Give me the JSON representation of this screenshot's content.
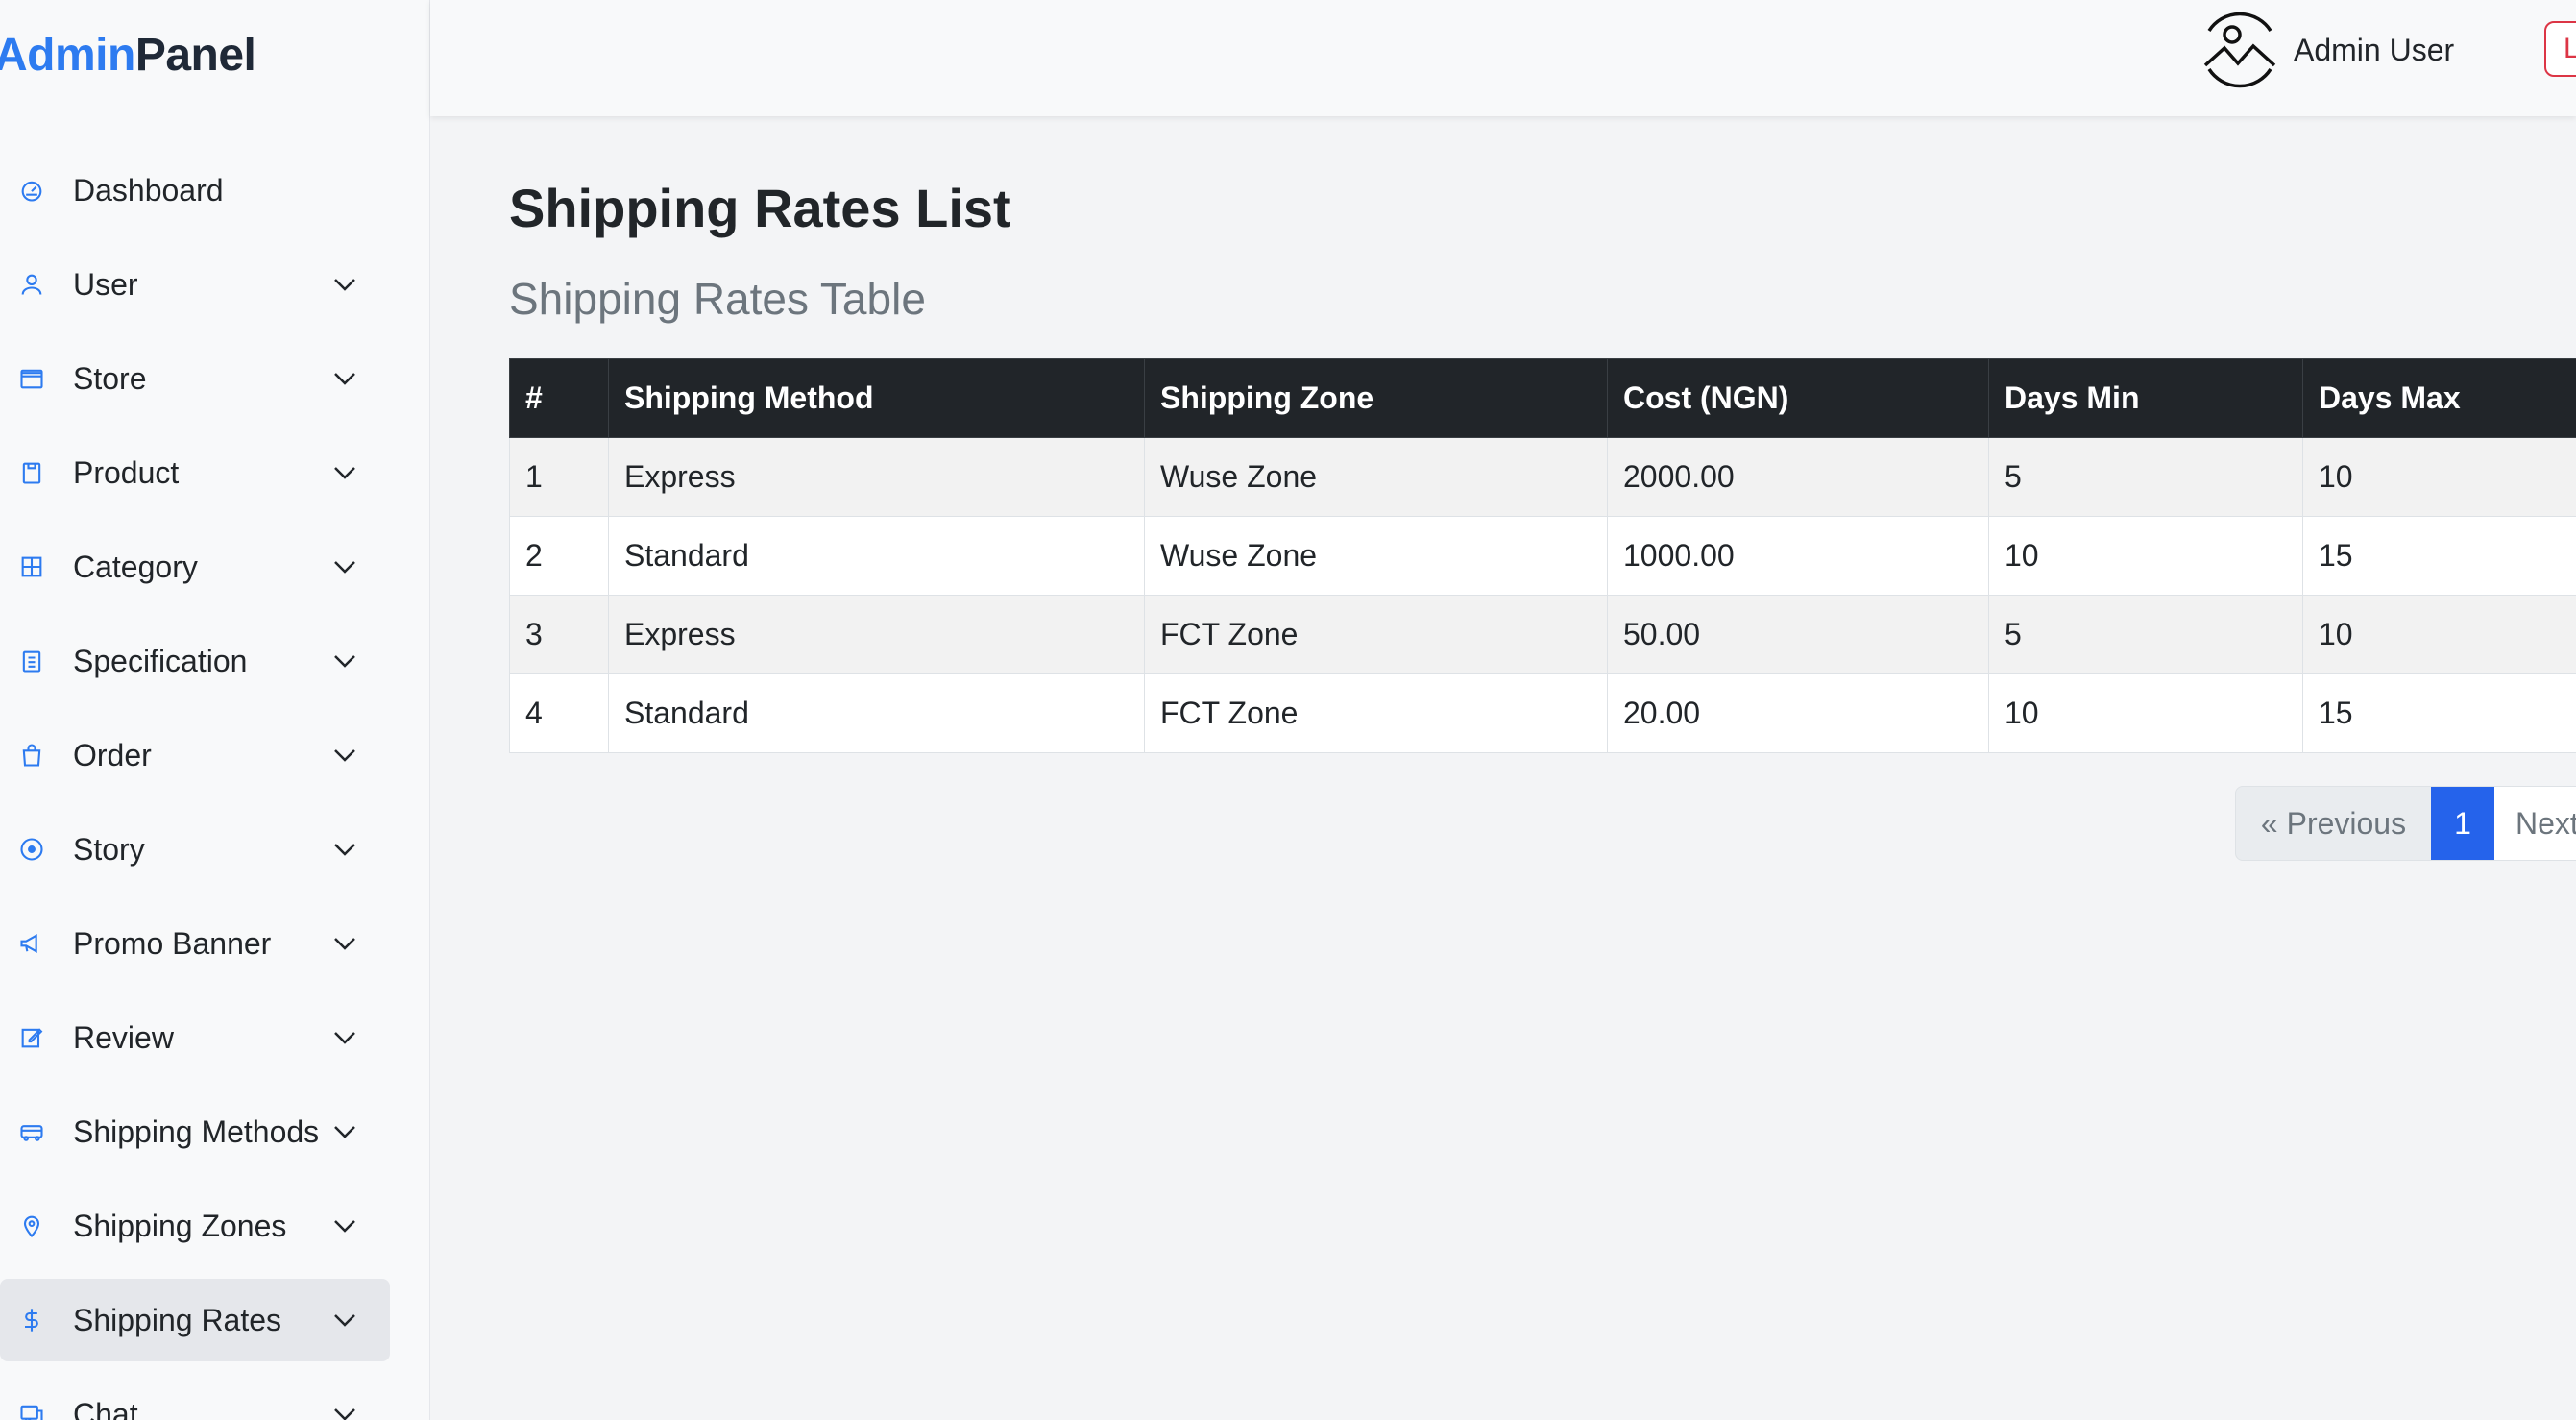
{
  "brand": {
    "part1": "Admin",
    "part2": "Panel"
  },
  "header": {
    "user_name": "Admin User",
    "logout_label": "Logout"
  },
  "sidebar": {
    "items": [
      {
        "label": "Dashboard",
        "icon": "dashboard-icon",
        "has_dropdown": false
      },
      {
        "label": "User",
        "icon": "user-icon",
        "has_dropdown": true
      },
      {
        "label": "Store",
        "icon": "store-icon",
        "has_dropdown": true
      },
      {
        "label": "Product",
        "icon": "product-icon",
        "has_dropdown": true
      },
      {
        "label": "Category",
        "icon": "category-icon",
        "has_dropdown": true
      },
      {
        "label": "Specification",
        "icon": "specification-icon",
        "has_dropdown": true
      },
      {
        "label": "Order",
        "icon": "order-icon",
        "has_dropdown": true
      },
      {
        "label": "Story",
        "icon": "story-icon",
        "has_dropdown": true
      },
      {
        "label": "Promo Banner",
        "icon": "megaphone-icon",
        "has_dropdown": true
      },
      {
        "label": "Review",
        "icon": "review-icon",
        "has_dropdown": true
      },
      {
        "label": "Shipping Methods",
        "icon": "truck-icon",
        "has_dropdown": true
      },
      {
        "label": "Shipping Zones",
        "icon": "map-pin-icon",
        "has_dropdown": true
      },
      {
        "label": "Shipping Rates",
        "icon": "dollar-icon",
        "has_dropdown": true,
        "active": true
      },
      {
        "label": "Chat",
        "icon": "chat-icon",
        "has_dropdown": true
      }
    ]
  },
  "main": {
    "page_title": "Shipping Rates List",
    "table_title": "Shipping Rates Table",
    "table": {
      "headers": [
        "#",
        "Shipping Method",
        "Shipping Zone",
        "Cost (NGN)",
        "Days Min",
        "Days Max"
      ],
      "rows": [
        [
          "1",
          "Express",
          "Wuse Zone",
          "2000.00",
          "5",
          "10"
        ],
        [
          "2",
          "Standard",
          "Wuse Zone",
          "1000.00",
          "10",
          "15"
        ],
        [
          "3",
          "Express",
          "FCT Zone",
          "50.00",
          "5",
          "10"
        ],
        [
          "4",
          "Standard",
          "FCT Zone",
          "20.00",
          "10",
          "15"
        ]
      ]
    },
    "pagination": {
      "previous": "« Previous",
      "current": "1",
      "next": "Next »"
    }
  },
  "colors": {
    "accent": "#2563eb",
    "header_dark": "#212529",
    "danger": "#dc3545",
    "muted": "#6c757d"
  }
}
